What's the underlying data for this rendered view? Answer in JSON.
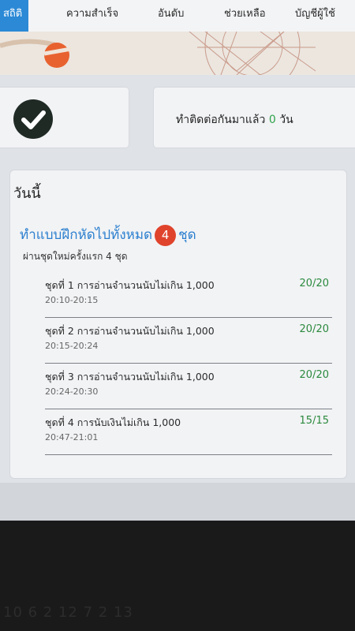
{
  "nav": {
    "tabs": [
      {
        "label": "สถิติ"
      },
      {
        "label": "ความสำเร็จ"
      },
      {
        "label": "อันดับ"
      },
      {
        "label": "ช่วยเหลือ"
      },
      {
        "label": "บัญชีผู้ใช้"
      }
    ]
  },
  "streak": {
    "prefix": "ทำติดต่อกันมาแล้ว",
    "count": "0",
    "suffix": "วัน"
  },
  "today": {
    "title": "วันนี้",
    "summary_prefix": "ทำแบบฝึกหัดไปทั้งหมด",
    "summary_count": "4",
    "summary_suffix": "ชุด",
    "subtitle": "ผ่านชุดใหม่ครั้งแรก 4 ชุด",
    "items": [
      {
        "title": "ชุดที่ 1 การอ่านจำนวนนับไม่เกิน 1,000",
        "time": "20:10-20:15",
        "score": "20/20"
      },
      {
        "title": "ชุดที่ 2 การอ่านจำนวนนับไม่เกิน 1,000",
        "time": "20:15-20:24",
        "score": "20/20"
      },
      {
        "title": "ชุดที่ 3 การอ่านจำนวนนับไม่เกิน 1,000",
        "time": "20:24-20:30",
        "score": "20/20"
      },
      {
        "title": "ชุดที่ 4 การนับเงินไม่เกิน 1,000",
        "time": "20:47-21:01",
        "score": "15/15"
      }
    ]
  },
  "colors": {
    "accent": "#2b89d6",
    "badge": "#e0432c",
    "score": "#2b8a3e",
    "check": "#1f2a25"
  },
  "icons": {
    "streak": "check-circle-icon"
  },
  "screen_reflection_text": "10 6 2 12 7 2 13"
}
